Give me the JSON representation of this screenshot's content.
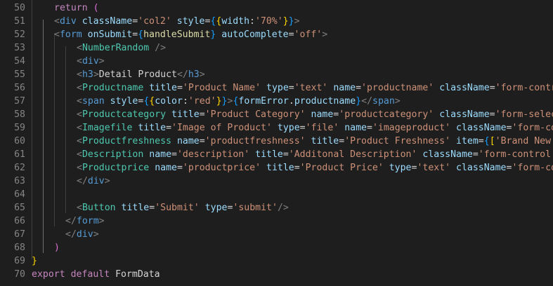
{
  "editor": {
    "lines": [
      {
        "num": "50",
        "indent": 2,
        "tokens": [
          {
            "t": "return ",
            "c": "kw"
          },
          {
            "t": "(",
            "c": "br2"
          }
        ]
      },
      {
        "num": "51",
        "indent": 2,
        "tokens": [
          {
            "t": "<",
            "c": "pun"
          },
          {
            "t": "div",
            "c": "tag"
          },
          {
            "t": " ",
            "c": "txt"
          },
          {
            "t": "className",
            "c": "attr"
          },
          {
            "t": "=",
            "c": "txt"
          },
          {
            "t": "'col2'",
            "c": "str"
          },
          {
            "t": " ",
            "c": "txt"
          },
          {
            "t": "style",
            "c": "attr"
          },
          {
            "t": "=",
            "c": "txt"
          },
          {
            "t": "{",
            "c": "br3"
          },
          {
            "t": "{",
            "c": "br1"
          },
          {
            "t": "width",
            "c": "attr"
          },
          {
            "t": ":",
            "c": "txt"
          },
          {
            "t": "'70%'",
            "c": "str"
          },
          {
            "t": "}",
            "c": "br1"
          },
          {
            "t": "}",
            "c": "br3"
          },
          {
            "t": ">",
            "c": "pun"
          }
        ]
      },
      {
        "num": "52",
        "indent": 2,
        "tokens": [
          {
            "t": "<",
            "c": "pun"
          },
          {
            "t": "form",
            "c": "tag"
          },
          {
            "t": " ",
            "c": "txt"
          },
          {
            "t": "onSubmit",
            "c": "attr"
          },
          {
            "t": "=",
            "c": "txt"
          },
          {
            "t": "{",
            "c": "br3"
          },
          {
            "t": "handleSubmit",
            "c": "fn"
          },
          {
            "t": "}",
            "c": "br3"
          },
          {
            "t": " ",
            "c": "txt"
          },
          {
            "t": "autoComplete",
            "c": "attr"
          },
          {
            "t": "=",
            "c": "txt"
          },
          {
            "t": "'off'",
            "c": "str"
          },
          {
            "t": ">",
            "c": "pun"
          }
        ]
      },
      {
        "num": "53",
        "indent": 4,
        "tokens": [
          {
            "t": "<",
            "c": "pun"
          },
          {
            "t": "NumberRandom",
            "c": "comp"
          },
          {
            "t": " />",
            "c": "pun"
          }
        ]
      },
      {
        "num": "54",
        "indent": 4,
        "tokens": [
          {
            "t": "<",
            "c": "pun"
          },
          {
            "t": "div",
            "c": "tag"
          },
          {
            "t": ">",
            "c": "pun"
          }
        ]
      },
      {
        "num": "55",
        "indent": 4,
        "tokens": [
          {
            "t": "<",
            "c": "pun"
          },
          {
            "t": "h3",
            "c": "tag"
          },
          {
            "t": ">",
            "c": "pun"
          },
          {
            "t": "Detail Product",
            "c": "txt"
          },
          {
            "t": "</",
            "c": "pun"
          },
          {
            "t": "h3",
            "c": "tag"
          },
          {
            "t": ">",
            "c": "pun"
          }
        ]
      },
      {
        "num": "56",
        "indent": 4,
        "tokens": [
          {
            "t": "<",
            "c": "pun"
          },
          {
            "t": "Productname",
            "c": "comp"
          },
          {
            "t": " ",
            "c": "txt"
          },
          {
            "t": "title",
            "c": "attr"
          },
          {
            "t": "=",
            "c": "txt"
          },
          {
            "t": "'Product Name'",
            "c": "str"
          },
          {
            "t": " ",
            "c": "txt"
          },
          {
            "t": "type",
            "c": "attr"
          },
          {
            "t": "=",
            "c": "txt"
          },
          {
            "t": "'text'",
            "c": "str"
          },
          {
            "t": " ",
            "c": "txt"
          },
          {
            "t": "name",
            "c": "attr"
          },
          {
            "t": "=",
            "c": "txt"
          },
          {
            "t": "'productname'",
            "c": "str"
          },
          {
            "t": " ",
            "c": "txt"
          },
          {
            "t": "className",
            "c": "attr"
          },
          {
            "t": "=",
            "c": "txt"
          },
          {
            "t": "'form-control",
            "c": "str"
          }
        ]
      },
      {
        "num": "57",
        "indent": 4,
        "tokens": [
          {
            "t": "<",
            "c": "pun"
          },
          {
            "t": "span",
            "c": "tag"
          },
          {
            "t": " ",
            "c": "txt"
          },
          {
            "t": "style",
            "c": "attr"
          },
          {
            "t": "=",
            "c": "txt"
          },
          {
            "t": "{",
            "c": "br3"
          },
          {
            "t": "{",
            "c": "br1"
          },
          {
            "t": "color",
            "c": "attr"
          },
          {
            "t": ":",
            "c": "txt"
          },
          {
            "t": "'red'",
            "c": "str"
          },
          {
            "t": "}",
            "c": "br1"
          },
          {
            "t": "}",
            "c": "br3"
          },
          {
            "t": ">",
            "c": "pun"
          },
          {
            "t": "{",
            "c": "br3"
          },
          {
            "t": "formError",
            "c": "attr"
          },
          {
            "t": ".",
            "c": "txt"
          },
          {
            "t": "productname",
            "c": "attr"
          },
          {
            "t": "}",
            "c": "br3"
          },
          {
            "t": "</",
            "c": "pun"
          },
          {
            "t": "span",
            "c": "tag"
          },
          {
            "t": ">",
            "c": "pun"
          }
        ]
      },
      {
        "num": "58",
        "indent": 4,
        "tokens": [
          {
            "t": "<",
            "c": "pun"
          },
          {
            "t": "Productcategory",
            "c": "comp"
          },
          {
            "t": " ",
            "c": "txt"
          },
          {
            "t": "title",
            "c": "attr"
          },
          {
            "t": "=",
            "c": "txt"
          },
          {
            "t": "'Product Category'",
            "c": "str"
          },
          {
            "t": " ",
            "c": "txt"
          },
          {
            "t": "name",
            "c": "attr"
          },
          {
            "t": "=",
            "c": "txt"
          },
          {
            "t": "'productcategory'",
            "c": "str"
          },
          {
            "t": " ",
            "c": "txt"
          },
          {
            "t": "className",
            "c": "attr"
          },
          {
            "t": "=",
            "c": "txt"
          },
          {
            "t": "'form-select'",
            "c": "str"
          }
        ]
      },
      {
        "num": "59",
        "indent": 4,
        "tokens": [
          {
            "t": "<",
            "c": "pun"
          },
          {
            "t": "Imagefile",
            "c": "comp"
          },
          {
            "t": " ",
            "c": "txt"
          },
          {
            "t": "title",
            "c": "attr"
          },
          {
            "t": "=",
            "c": "txt"
          },
          {
            "t": "'Image of Product'",
            "c": "str"
          },
          {
            "t": " ",
            "c": "txt"
          },
          {
            "t": "type",
            "c": "attr"
          },
          {
            "t": "=",
            "c": "txt"
          },
          {
            "t": "'file'",
            "c": "str"
          },
          {
            "t": " ",
            "c": "txt"
          },
          {
            "t": "name",
            "c": "attr"
          },
          {
            "t": "=",
            "c": "txt"
          },
          {
            "t": "'imageproduct'",
            "c": "str"
          },
          {
            "t": " ",
            "c": "txt"
          },
          {
            "t": "className",
            "c": "attr"
          },
          {
            "t": "=",
            "c": "txt"
          },
          {
            "t": "'form-contr",
            "c": "str"
          }
        ]
      },
      {
        "num": "60",
        "indent": 4,
        "tokens": [
          {
            "t": "<",
            "c": "pun"
          },
          {
            "t": "Productfreshness",
            "c": "comp"
          },
          {
            "t": " ",
            "c": "txt"
          },
          {
            "t": "name",
            "c": "attr"
          },
          {
            "t": "=",
            "c": "txt"
          },
          {
            "t": "'productfreshness'",
            "c": "str"
          },
          {
            "t": " ",
            "c": "txt"
          },
          {
            "t": "title",
            "c": "attr"
          },
          {
            "t": "=",
            "c": "txt"
          },
          {
            "t": "'Product Freshness'",
            "c": "str"
          },
          {
            "t": " ",
            "c": "txt"
          },
          {
            "t": "item",
            "c": "attr"
          },
          {
            "t": "=",
            "c": "txt"
          },
          {
            "t": "{",
            "c": "br3"
          },
          {
            "t": "[",
            "c": "br1"
          },
          {
            "t": "'Brand New',",
            "c": "str"
          }
        ]
      },
      {
        "num": "61",
        "indent": 4,
        "tokens": [
          {
            "t": "<",
            "c": "pun"
          },
          {
            "t": "Description",
            "c": "comp"
          },
          {
            "t": " ",
            "c": "txt"
          },
          {
            "t": "name",
            "c": "attr"
          },
          {
            "t": "=",
            "c": "txt"
          },
          {
            "t": "'description'",
            "c": "str"
          },
          {
            "t": " ",
            "c": "txt"
          },
          {
            "t": "title",
            "c": "attr"
          },
          {
            "t": "=",
            "c": "txt"
          },
          {
            "t": "'Additonal Description'",
            "c": "str"
          },
          {
            "t": " ",
            "c": "txt"
          },
          {
            "t": "className",
            "c": "attr"
          },
          {
            "t": "=",
            "c": "txt"
          },
          {
            "t": "'form-control'",
            "c": "str"
          },
          {
            "t": " /",
            "c": "pun"
          }
        ]
      },
      {
        "num": "62",
        "indent": 4,
        "tokens": [
          {
            "t": "<",
            "c": "pun"
          },
          {
            "t": "Productprice",
            "c": "comp"
          },
          {
            "t": " ",
            "c": "txt"
          },
          {
            "t": "name",
            "c": "attr"
          },
          {
            "t": "=",
            "c": "txt"
          },
          {
            "t": "'productprice'",
            "c": "str"
          },
          {
            "t": " ",
            "c": "txt"
          },
          {
            "t": "title",
            "c": "attr"
          },
          {
            "t": "=",
            "c": "txt"
          },
          {
            "t": "'Product Price'",
            "c": "str"
          },
          {
            "t": " ",
            "c": "txt"
          },
          {
            "t": "type",
            "c": "attr"
          },
          {
            "t": "=",
            "c": "txt"
          },
          {
            "t": "'text'",
            "c": "str"
          },
          {
            "t": " ",
            "c": "txt"
          },
          {
            "t": "className",
            "c": "attr"
          },
          {
            "t": "=",
            "c": "txt"
          },
          {
            "t": "'form-contr",
            "c": "str"
          }
        ]
      },
      {
        "num": "63",
        "indent": 4,
        "tokens": [
          {
            "t": "</",
            "c": "pun"
          },
          {
            "t": "div",
            "c": "tag"
          },
          {
            "t": ">",
            "c": "pun"
          }
        ]
      },
      {
        "num": "64",
        "indent": 4,
        "tokens": []
      },
      {
        "num": "65",
        "indent": 4,
        "tokens": [
          {
            "t": "<",
            "c": "pun"
          },
          {
            "t": "Button",
            "c": "comp"
          },
          {
            "t": " ",
            "c": "txt"
          },
          {
            "t": "title",
            "c": "attr"
          },
          {
            "t": "=",
            "c": "txt"
          },
          {
            "t": "'Submit'",
            "c": "str"
          },
          {
            "t": " ",
            "c": "txt"
          },
          {
            "t": "type",
            "c": "attr"
          },
          {
            "t": "=",
            "c": "txt"
          },
          {
            "t": "'submit'",
            "c": "str"
          },
          {
            "t": "/>",
            "c": "pun"
          }
        ]
      },
      {
        "num": "66",
        "indent": 3,
        "tokens": [
          {
            "t": "</",
            "c": "pun"
          },
          {
            "t": "form",
            "c": "tag"
          },
          {
            "t": ">",
            "c": "pun"
          }
        ]
      },
      {
        "num": "67",
        "indent": 3,
        "tokens": [
          {
            "t": "</",
            "c": "pun"
          },
          {
            "t": "div",
            "c": "tag"
          },
          {
            "t": ">",
            "c": "pun"
          }
        ]
      },
      {
        "num": "68",
        "indent": 2,
        "tokens": [
          {
            "t": ")",
            "c": "br2"
          }
        ]
      },
      {
        "num": "69",
        "indent": 0,
        "tokens": [
          {
            "t": "}",
            "c": "br1"
          }
        ]
      },
      {
        "num": "70",
        "indent": 0,
        "tokens": [
          {
            "t": "export ",
            "c": "kw"
          },
          {
            "t": "default ",
            "c": "kw"
          },
          {
            "t": "FormData",
            "c": "txt"
          }
        ]
      }
    ]
  }
}
